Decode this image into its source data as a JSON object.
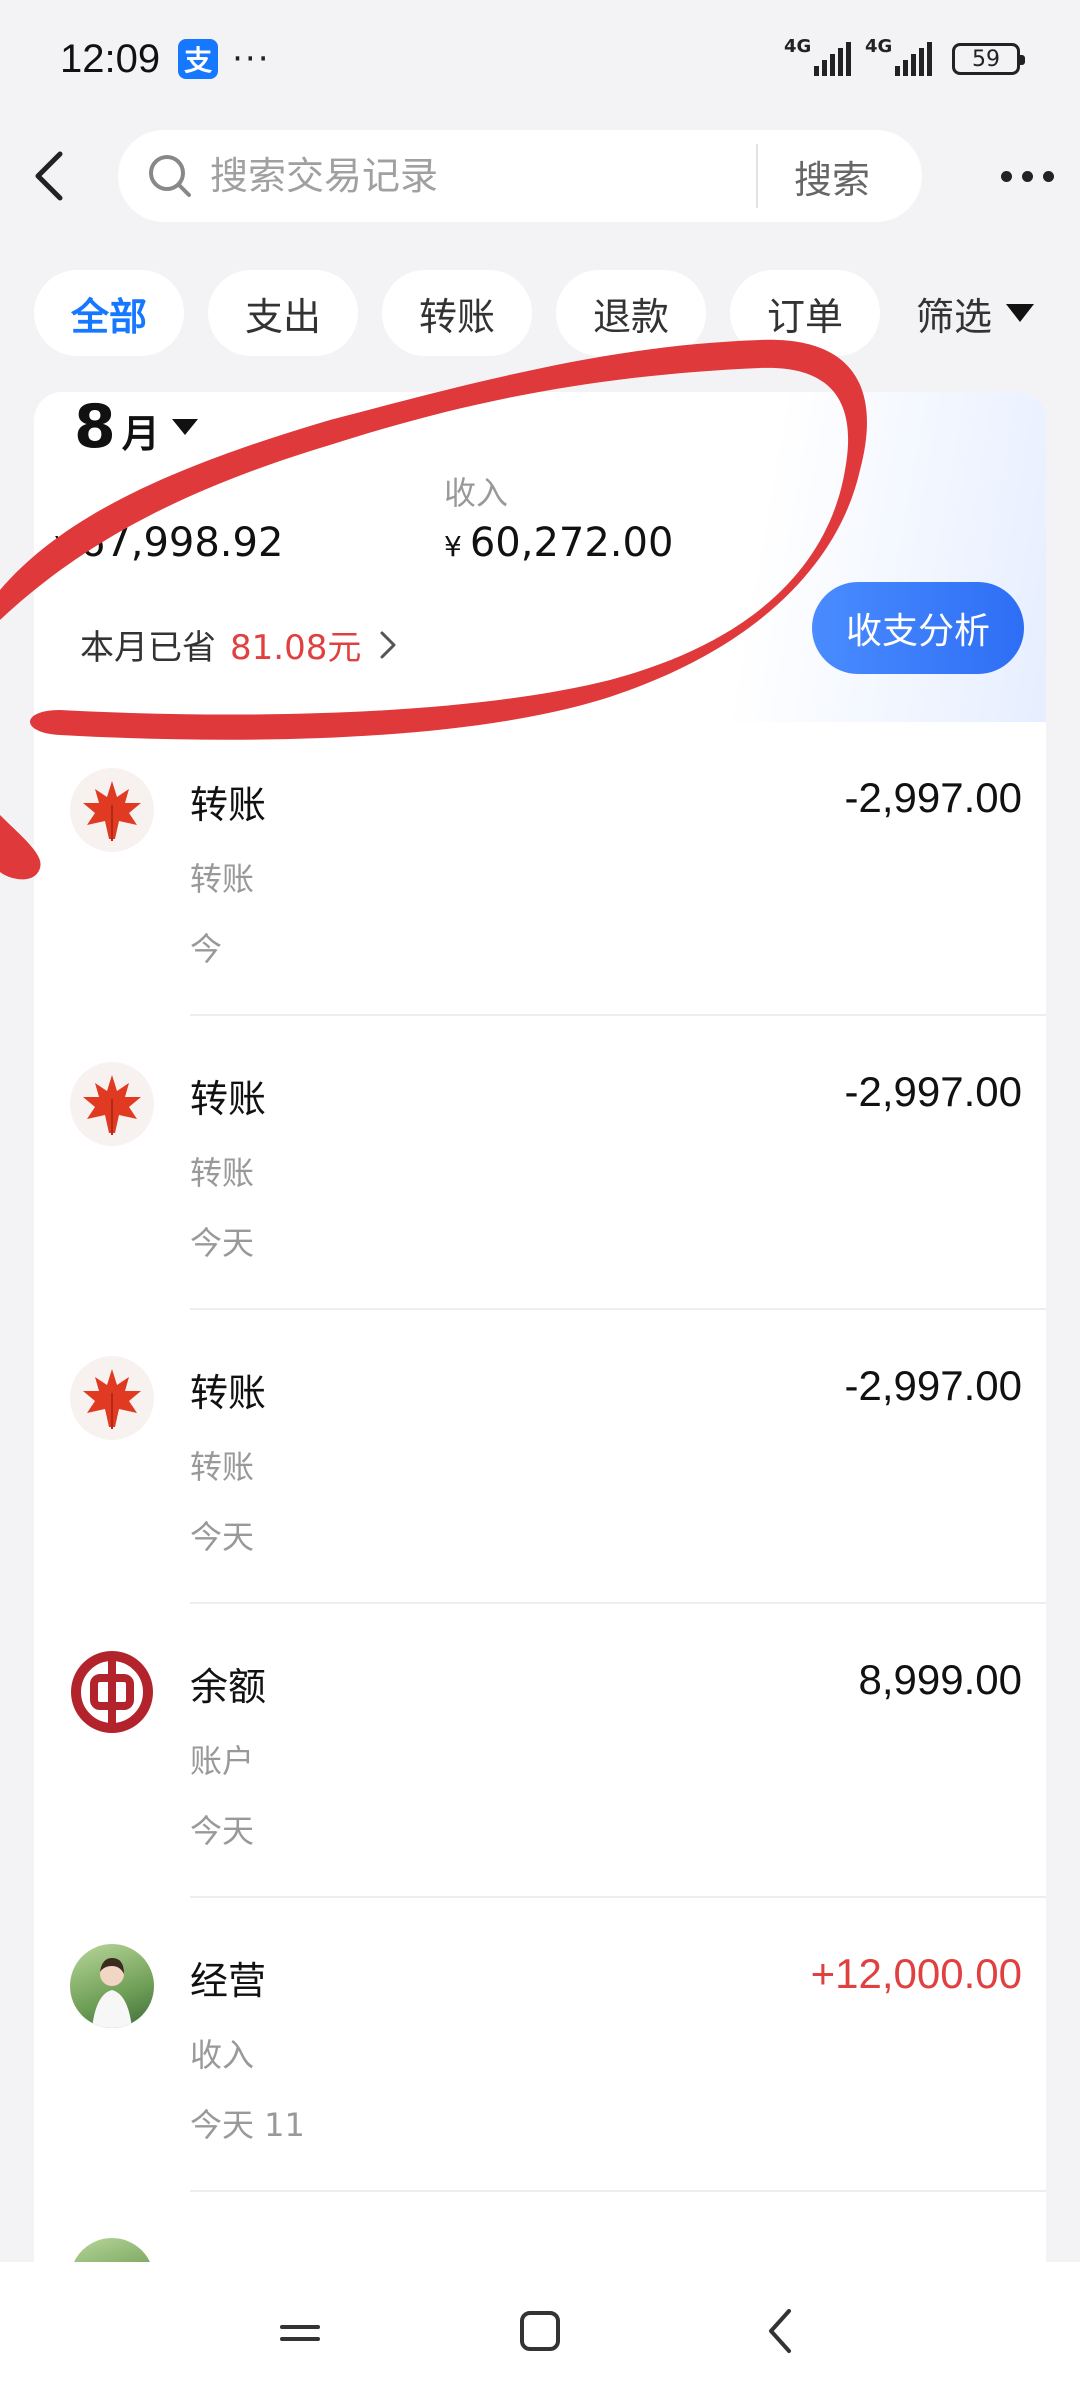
{
  "status_bar": {
    "time": "12:09",
    "app_badge": "支",
    "more": "···",
    "network_1": "4G",
    "network_2": "4G",
    "battery": "59"
  },
  "search": {
    "placeholder": "搜索交易记录",
    "button_label": "搜索"
  },
  "filters": {
    "chips": [
      "全部",
      "支出",
      "转账",
      "退款",
      "订单"
    ],
    "more_label": "筛选"
  },
  "summary": {
    "month": "8",
    "month_unit": "月",
    "expense_value": "67,998.92",
    "income_label": "收入",
    "income_value": "60,272.00",
    "currency": "¥",
    "saved_label": "本月已省",
    "saved_amount": "81.08元",
    "analysis_button": "收支分析"
  },
  "transactions": [
    {
      "icon": "maple-leaf-icon",
      "title": "转账",
      "subtitle": "转账",
      "time": "今",
      "amount": "-2,997.00",
      "type": "expense"
    },
    {
      "icon": "maple-leaf-icon",
      "title": "转账",
      "subtitle": "转账",
      "time": "今天",
      "amount": "-2,997.00",
      "type": "expense"
    },
    {
      "icon": "maple-leaf-icon",
      "title": "转账",
      "subtitle": "转账",
      "time": "今天",
      "amount": "-2,997.00",
      "type": "expense"
    },
    {
      "icon": "bank-of-china-icon",
      "title": "余额",
      "subtitle": "账户",
      "time": "今天",
      "amount": "8,999.00",
      "type": "neutral"
    },
    {
      "icon": "person-avatar",
      "title": "经营",
      "subtitle": "收入",
      "time": "今天 11",
      "amount": "+12,000.00",
      "type": "income"
    }
  ],
  "colors": {
    "accent": "#1677ff",
    "income": "#e0403f",
    "annotation": "#e0393c"
  }
}
